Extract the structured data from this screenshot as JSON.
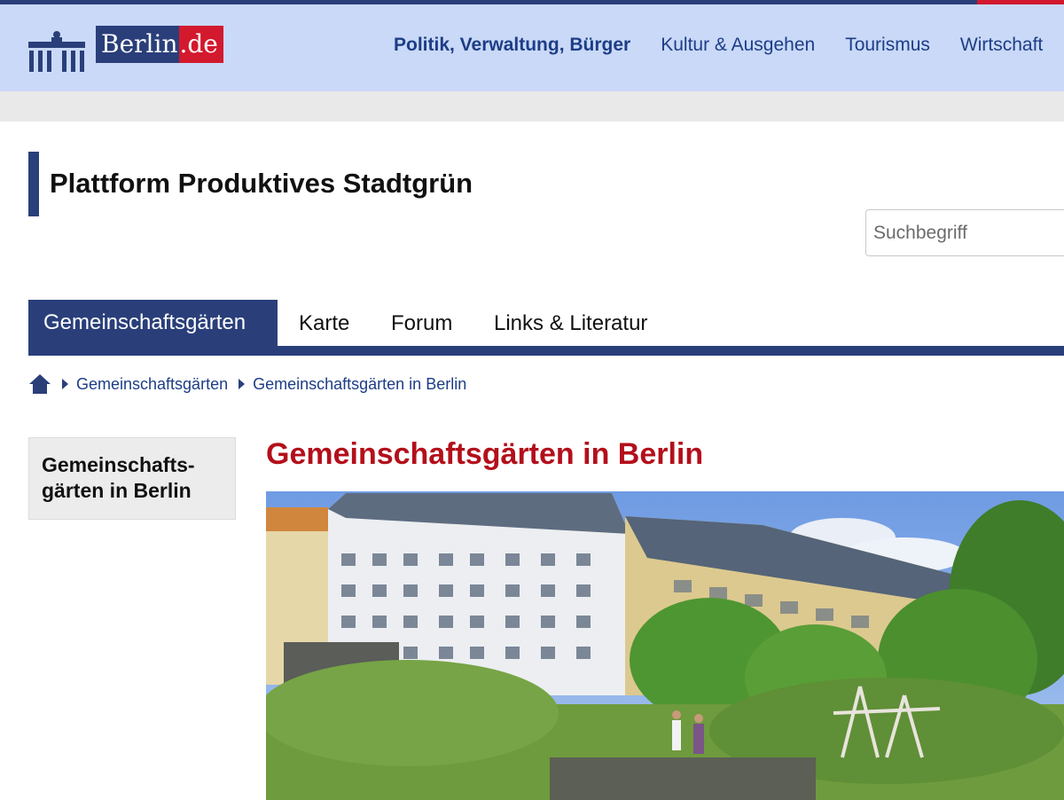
{
  "colors": {
    "brand_blue": "#2a3f7a",
    "header_bg": "#c9d9f7",
    "brand_red": "#d3192e",
    "heading_red": "#b30f1b",
    "link_blue": "#1d3d87"
  },
  "header": {
    "logo": {
      "text_main": "Berlin",
      "text_suffix": ".de",
      "icon": "brandenburg-gate-icon"
    },
    "nav": [
      {
        "label": "Politik, Verwaltung, Bürger",
        "active": true
      },
      {
        "label": "Kultur & Ausgehen"
      },
      {
        "label": "Tourismus"
      },
      {
        "label": "Wirtschaft"
      }
    ]
  },
  "site": {
    "title": "Plattform Produktives Stadtgrün"
  },
  "search": {
    "placeholder": "Suchbegriff",
    "value": ""
  },
  "tabs": [
    {
      "label": "Gemeinschaftsgärten",
      "active": true
    },
    {
      "label": "Karte"
    },
    {
      "label": "Forum"
    },
    {
      "label": "Links & Literatur"
    }
  ],
  "breadcrumb": {
    "home_icon": "home-icon",
    "items": [
      {
        "label": "Gemeinschaftsgärten"
      },
      {
        "label": "Gemeinschaftsgärten in Berlin"
      }
    ]
  },
  "sidenav": {
    "items": [
      {
        "label": "Gemeinschafts-gärten in Berlin"
      }
    ]
  },
  "main": {
    "heading": "Gemeinschaftsgärten in Berlin"
  }
}
